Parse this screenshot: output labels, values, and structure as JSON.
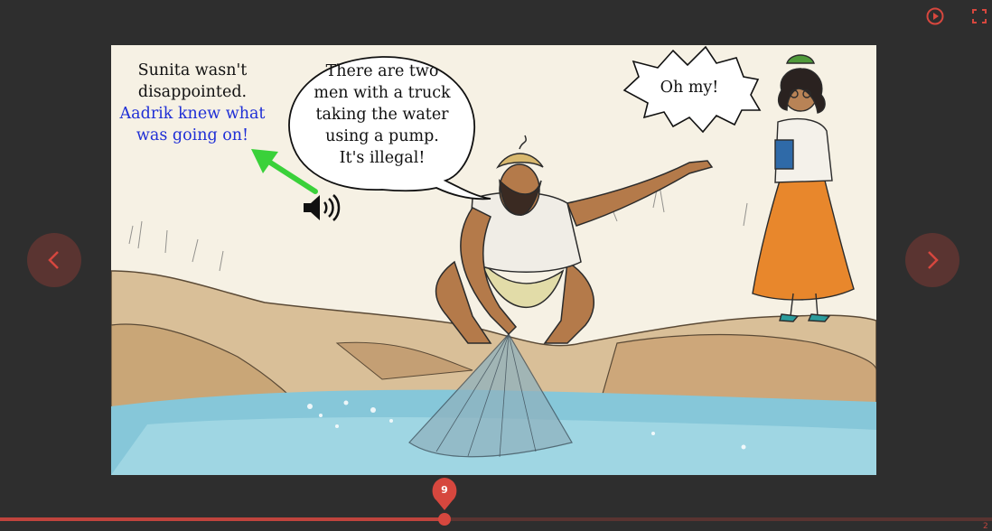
{
  "controls": {
    "play_icon": "play-circle-icon",
    "fullscreen_icon": "fullscreen-icon",
    "prev_icon": "chevron-left-icon",
    "next_icon": "chevron-right-icon",
    "accent_color": "#d6473e",
    "button_color": "#5a3431"
  },
  "story": {
    "narration": {
      "line1": "Sunita wasn't",
      "line2": "disappointed.",
      "line3": "Aadrik knew what",
      "line4": "was going on!"
    },
    "speech_main": {
      "line1": "There are two",
      "line2": "men with a truck",
      "line3": "taking the water",
      "line4": "using a pump.",
      "line5": "It's illegal!"
    },
    "speech_small": "Oh my!",
    "highlight_color": "#1f2fd6",
    "audio_icon": "speaker-icon",
    "pointer_arrow_icon": "green-arrow-icon"
  },
  "timeline": {
    "current_page": "9",
    "total_pages_partial": "2",
    "progress": 0.448
  }
}
